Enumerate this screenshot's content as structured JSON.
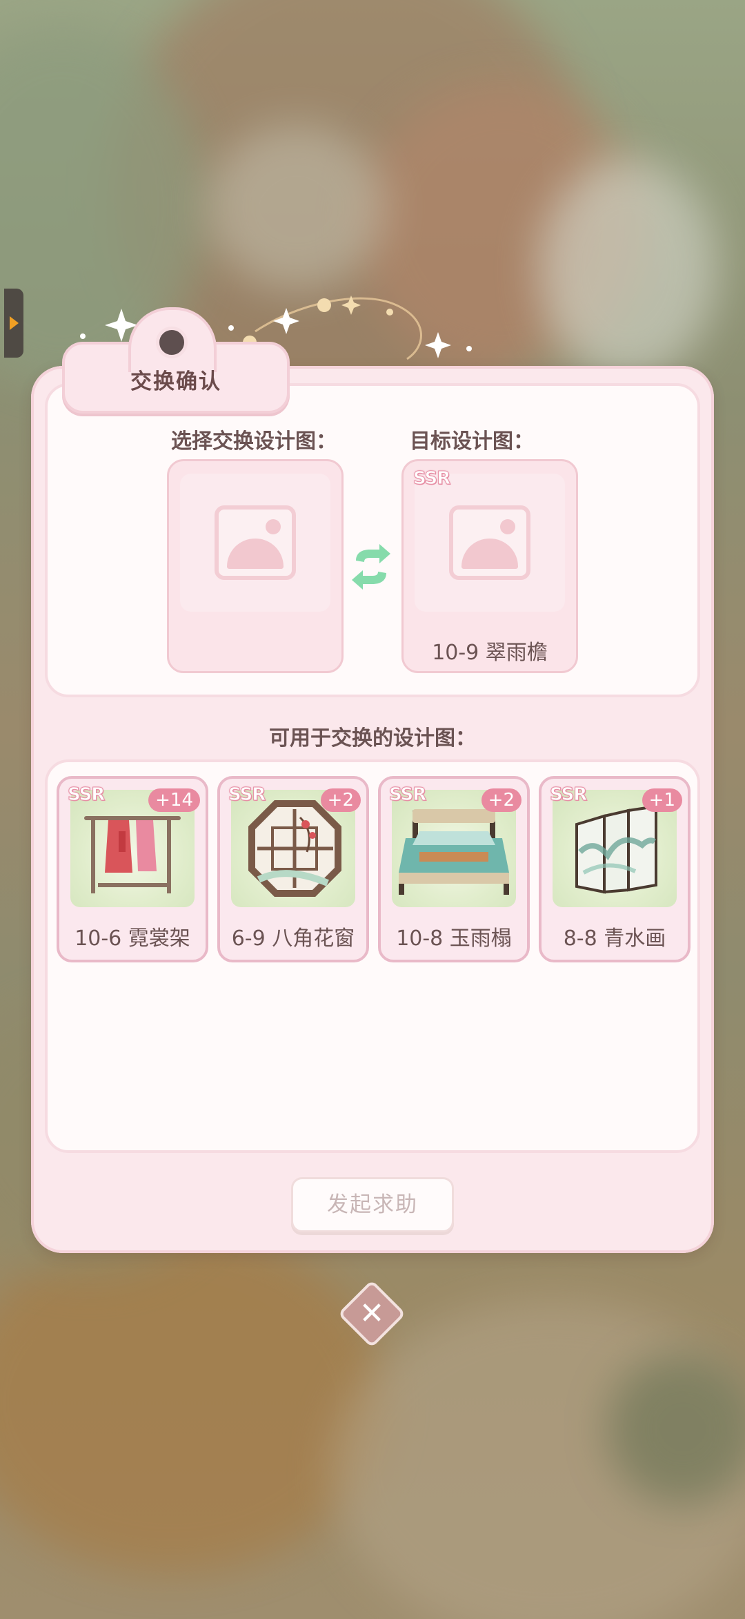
{
  "dialog": {
    "title": "交换确认",
    "select_label": "选择交换设计图：",
    "target_label": "目标设计图：",
    "target": {
      "rarity": "SSR",
      "name": "10-9 翠雨檐"
    },
    "available_label": "可用于交换的设计图：",
    "items": [
      {
        "rarity": "SSR",
        "count": "+14",
        "name": "10-6 霓裳架",
        "icon": "clothes-rack-icon"
      },
      {
        "rarity": "SSR",
        "count": "+2",
        "name": "6-9 八角花窗",
        "icon": "octagonal-window-icon"
      },
      {
        "rarity": "SSR",
        "count": "+2",
        "name": "10-8 玉雨榻",
        "icon": "bed-icon"
      },
      {
        "rarity": "SSR",
        "count": "+1",
        "name": "8-8 青水画",
        "icon": "folding-screen-icon"
      }
    ],
    "help_button": "发起求助"
  },
  "colors": {
    "accent_pink": "#e98aa0",
    "panel_bg": "#fbe8ec",
    "swap_green": "#7ed6a6"
  }
}
